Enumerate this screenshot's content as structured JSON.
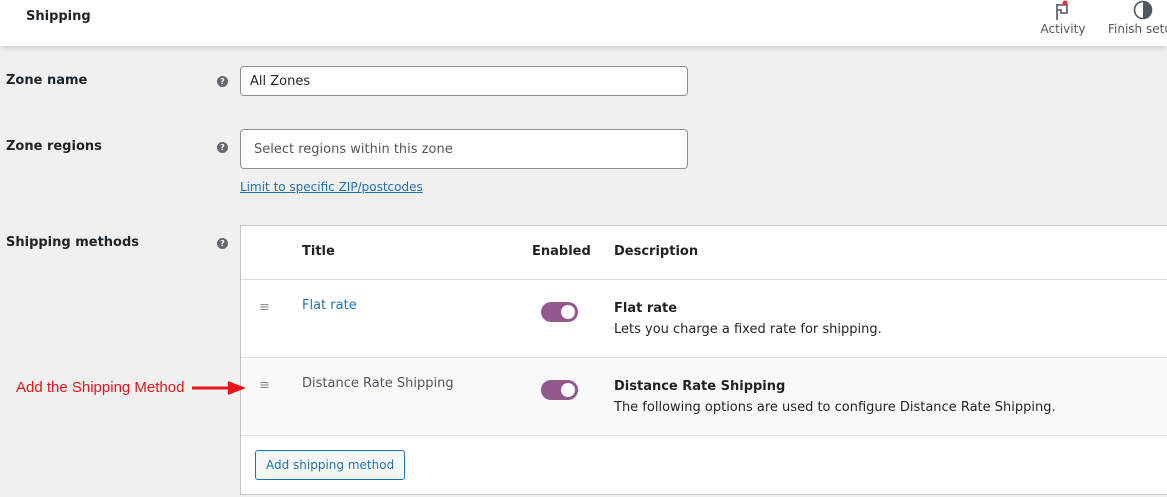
{
  "header": {
    "title": "Shipping",
    "activity": "Activity",
    "finish_setup": "Finish setup"
  },
  "form": {
    "zone_name_label": "Zone name",
    "zone_name_value": "All Zones",
    "zone_regions_label": "Zone regions",
    "zone_regions_placeholder": "Select regions within this zone",
    "limit_link": "Limit to specific ZIP/postcodes",
    "shipping_methods_label": "Shipping methods",
    "help": "?"
  },
  "table": {
    "headers": {
      "title": "Title",
      "enabled": "Enabled",
      "description": "Description"
    },
    "rows": [
      {
        "title": "Flat rate",
        "enabled": true,
        "desc_title": "Flat rate",
        "desc": "Lets you charge a fixed rate for shipping."
      },
      {
        "title": "Distance Rate Shipping",
        "enabled": true,
        "desc_title": "Distance Rate Shipping",
        "desc": "The following options are used to configure Distance Rate Shipping."
      }
    ],
    "add_button": "Add shipping method"
  },
  "annotation": {
    "text": "Add the Shipping Method",
    "color": "#e8141b"
  }
}
